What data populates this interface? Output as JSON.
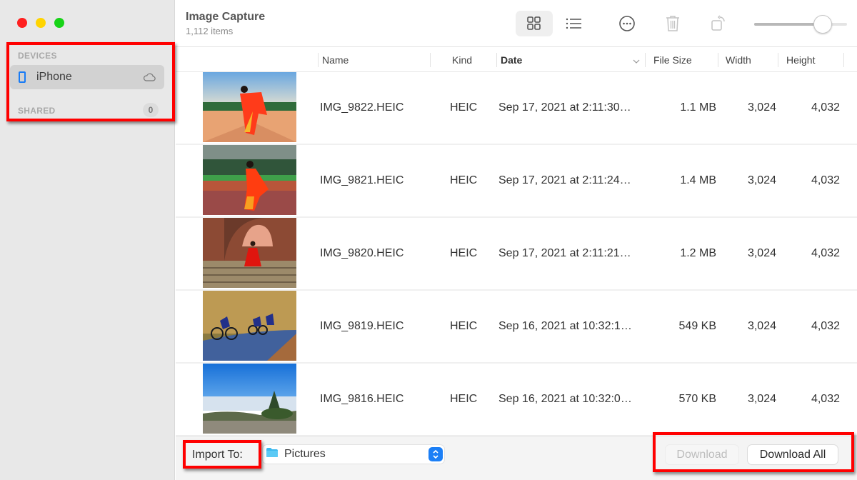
{
  "window": {
    "title": "Image Capture",
    "item_count": "1,112 items"
  },
  "sidebar": {
    "devices_label": "DEVICES",
    "device": {
      "name": "iPhone",
      "icon": "iphone-icon",
      "status_icon": "cloud-icon"
    },
    "shared_label": "SHARED",
    "shared_count": "0"
  },
  "toolbar": {
    "view_grid_icon": "grid-view-icon",
    "view_list_icon": "list-view-icon",
    "more_icon": "ellipsis-circle-icon",
    "delete_icon": "trash-icon",
    "rotate_icon": "rotate-icon",
    "thumbnail_size_fraction": 0.74
  },
  "table": {
    "columns": [
      "Name",
      "Kind",
      "Date",
      "File Size",
      "Width",
      "Height"
    ],
    "sorted_by": "Date",
    "rows": [
      {
        "name": "IMG_9822.HEIC",
        "kind": "HEIC",
        "date": "Sep 17, 2021 at 2:11:30…",
        "size": "1.1 MB",
        "width": "3,024",
        "height": "4,032",
        "thumb": "woman in red sari on terrace"
      },
      {
        "name": "IMG_9821.HEIC",
        "kind": "HEIC",
        "date": "Sep 17, 2021 at 2:11:24…",
        "size": "1.4 MB",
        "width": "3,024",
        "height": "4,032",
        "thumb": "woman in red sari by garden wall"
      },
      {
        "name": "IMG_9820.HEIC",
        "kind": "HEIC",
        "date": "Sep 17, 2021 at 2:11:21…",
        "size": "1.2 MB",
        "width": "3,024",
        "height": "4,032",
        "thumb": "woman in red dress on stone stairs"
      },
      {
        "name": "IMG_9819.HEIC",
        "kind": "HEIC",
        "date": "Sep 16, 2021 at 10:32:1…",
        "size": "549 KB",
        "width": "3,024",
        "height": "4,032",
        "thumb": "cyclists on forest road"
      },
      {
        "name": "IMG_9816.HEIC",
        "kind": "HEIC",
        "date": "Sep 16, 2021 at 10:32:0…",
        "size": "570 KB",
        "width": "3,024",
        "height": "4,032",
        "thumb": "blue sky over clouds and tree"
      }
    ]
  },
  "bottom": {
    "import_label": "Import To:",
    "import_destination": "Pictures",
    "download_label": "Download",
    "download_all_label": "Download All"
  },
  "colors": {
    "accent": "#1c7ff6",
    "annotation": "#ff0000"
  }
}
